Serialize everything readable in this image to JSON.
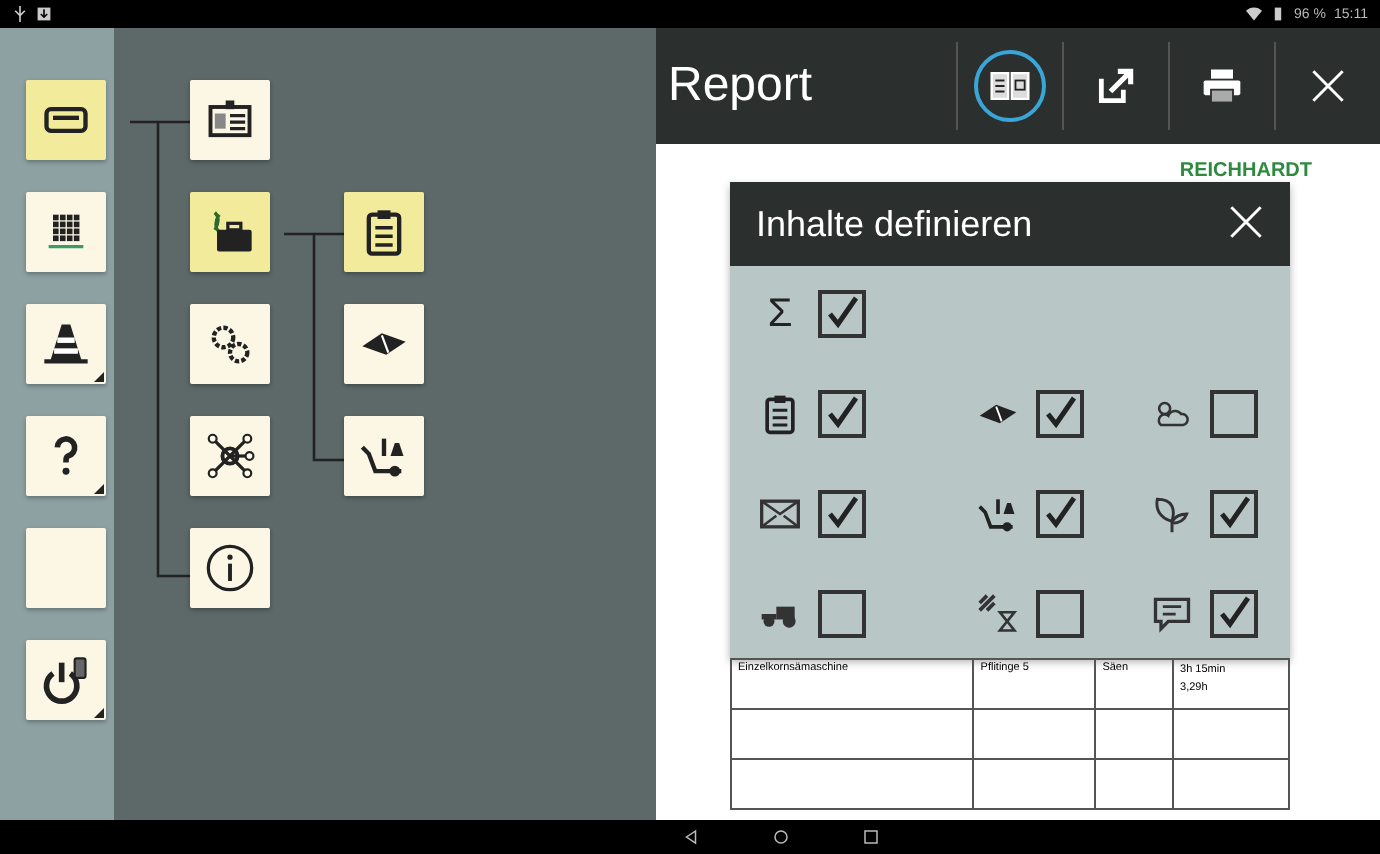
{
  "status_bar": {
    "battery": "96 %",
    "time": "15:11"
  },
  "sidebar": {
    "items": [
      {
        "kind": "menu",
        "selected": true
      },
      {
        "kind": "grid",
        "selected": false
      },
      {
        "kind": "cone",
        "selected": false
      },
      {
        "kind": "help",
        "selected": false
      },
      {
        "kind": "blank",
        "selected": false
      },
      {
        "kind": "power",
        "selected": false
      }
    ]
  },
  "tree": {
    "items": [
      {
        "kind": "id-card",
        "selected": false
      },
      {
        "kind": "briefcase",
        "selected": true,
        "children": [
          {
            "kind": "clipboard",
            "selected": true
          },
          {
            "kind": "field",
            "selected": false
          },
          {
            "kind": "cart",
            "selected": false
          }
        ]
      },
      {
        "kind": "gears",
        "selected": false
      },
      {
        "kind": "network",
        "selected": false
      },
      {
        "kind": "info",
        "selected": false
      }
    ]
  },
  "report": {
    "title": "Report",
    "toolbar": [
      {
        "kind": "contents",
        "selected": true
      },
      {
        "kind": "export",
        "selected": false
      },
      {
        "kind": "print",
        "selected": false
      },
      {
        "kind": "close",
        "selected": false
      }
    ],
    "logo": "REICHHARDT",
    "table": {
      "rows": [
        [
          "Einzelkornsämaschine",
          "Pflitinge 5",
          "Säen",
          "3h 15min",
          "3,29h"
        ]
      ]
    }
  },
  "dialog": {
    "title": "Inhalte definieren",
    "rows": [
      [
        {
          "kind": "sum",
          "symbol": "Σ",
          "checked": true
        }
      ],
      [
        {
          "kind": "clipboard",
          "checked": true
        },
        {
          "kind": "field",
          "checked": true
        },
        {
          "kind": "weather",
          "checked": false
        }
      ],
      [
        {
          "kind": "envelope",
          "checked": true
        },
        {
          "kind": "cart",
          "checked": true
        },
        {
          "kind": "plant",
          "checked": true
        }
      ],
      [
        {
          "kind": "tractor",
          "checked": false
        },
        {
          "kind": "timer",
          "checked": false
        },
        {
          "kind": "comment",
          "checked": true
        }
      ]
    ]
  }
}
